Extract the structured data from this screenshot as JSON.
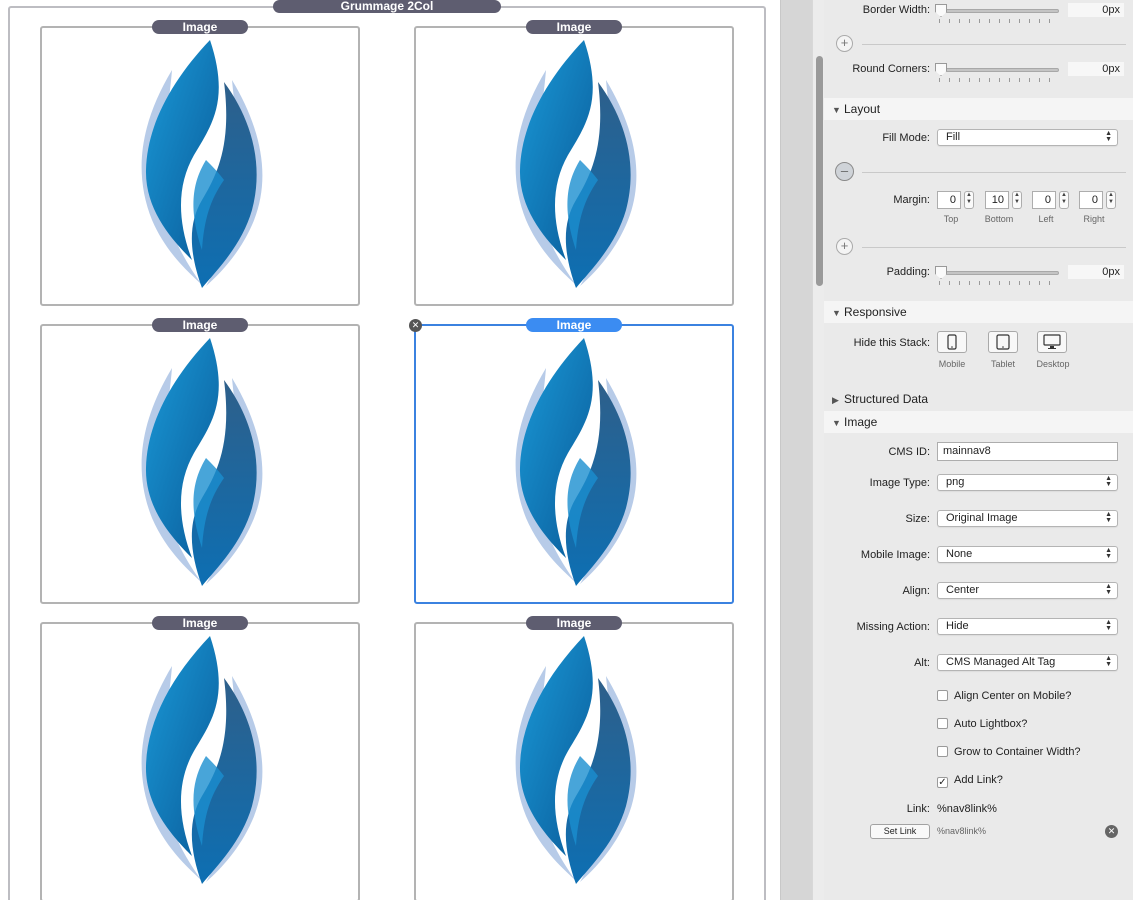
{
  "canvas": {
    "stack_title": "Grummage 2Col",
    "image_tile_label": "Image",
    "tiles": [
      {
        "label": "Image",
        "selected": false
      },
      {
        "label": "Image",
        "selected": false
      },
      {
        "label": "Image",
        "selected": false
      },
      {
        "label": "Image",
        "selected": true
      },
      {
        "label": "Image",
        "selected": false
      },
      {
        "label": "Image",
        "selected": false
      }
    ],
    "delete_glyph": "✕"
  },
  "inspector": {
    "border_width": {
      "label": "Border Width:",
      "value": "0px"
    },
    "round_corners": {
      "label": "Round Corners:",
      "value": "0px"
    },
    "layout": {
      "title": "Layout",
      "fill_mode_label": "Fill Mode:",
      "fill_mode_value": "Fill",
      "margin_label": "Margin:",
      "margin": [
        {
          "value": "0",
          "caption": "Top"
        },
        {
          "value": "10",
          "caption": "Bottom"
        },
        {
          "value": "0",
          "caption": "Left"
        },
        {
          "value": "0",
          "caption": "Right"
        }
      ],
      "padding_label": "Padding:",
      "padding_value": "0px"
    },
    "responsive": {
      "title": "Responsive",
      "hide_label": "Hide this Stack:",
      "devices": [
        "Mobile",
        "Tablet",
        "Desktop"
      ]
    },
    "structured_data": {
      "title": "Structured Data"
    },
    "image": {
      "title": "Image",
      "cms_id_label": "CMS ID:",
      "cms_id_value": "mainnav8",
      "fields": [
        {
          "label": "Image Type:",
          "value": "png"
        },
        {
          "label": "Size:",
          "value": "Original Image"
        },
        {
          "label": "Mobile Image:",
          "value": "None"
        },
        {
          "label": "Align:",
          "value": "Center"
        },
        {
          "label": "Missing Action:",
          "value": "Hide"
        },
        {
          "label": "Alt:",
          "value": "CMS Managed Alt Tag"
        }
      ],
      "checkboxes": [
        {
          "label": "Align Center on Mobile?",
          "checked": false
        },
        {
          "label": "Auto Lightbox?",
          "checked": false
        },
        {
          "label": "Grow to Container Width?",
          "checked": false
        },
        {
          "label": "Add Link?",
          "checked": true
        }
      ],
      "link_label": "Link:",
      "link_value": "%nav8link%",
      "set_link_button": "Set Link",
      "set_link_value": "%nav8link%"
    },
    "colors": {
      "accent": "#3b8cf2",
      "tab": "#5e5d70",
      "panel": "#eaeaea"
    }
  }
}
